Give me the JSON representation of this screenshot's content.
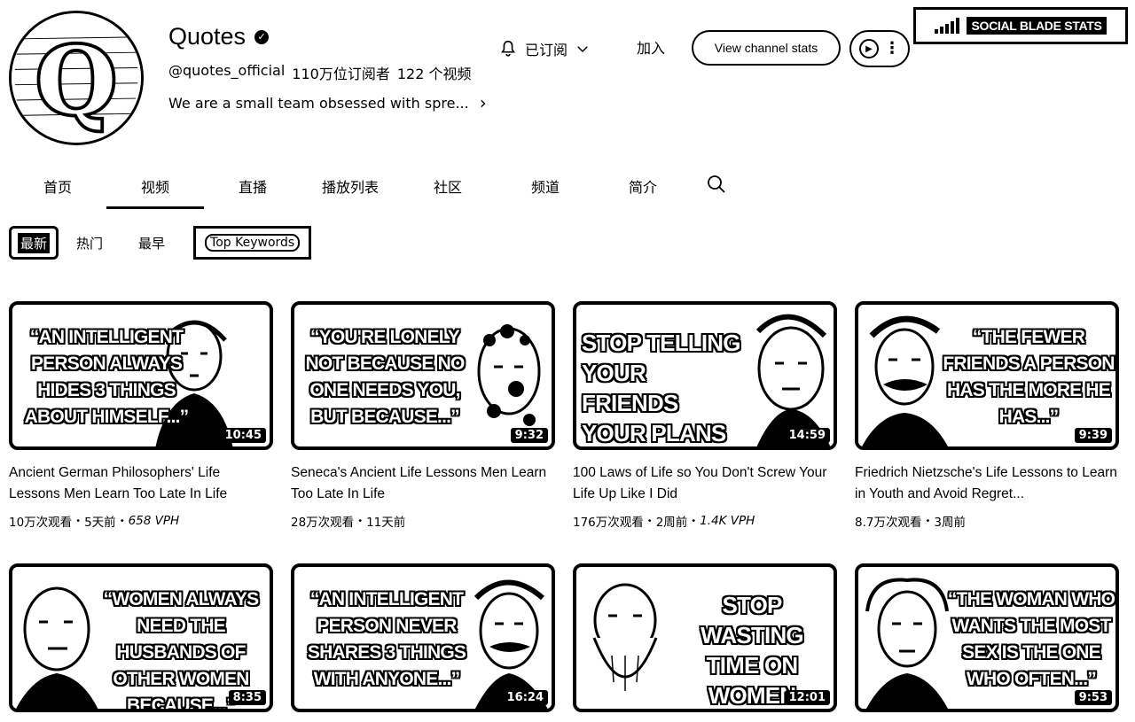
{
  "channel": {
    "name": "Quotes",
    "verified_icon": "check-icon",
    "handle": "@quotes_official",
    "subscribers": "110万位订阅者",
    "video_count": "122 个视频",
    "description": "We are a small team obsessed with spre..."
  },
  "actions": {
    "subscribed_label": "已订阅",
    "join_label": "加入",
    "stats_label": "View channel stats"
  },
  "social_blade": {
    "label": "SOCIAL BLADE STATS"
  },
  "tabs": [
    {
      "label": "首页",
      "active": false
    },
    {
      "label": "视频",
      "active": true
    },
    {
      "label": "直播",
      "active": false
    },
    {
      "label": "播放列表",
      "active": false
    },
    {
      "label": "社区",
      "active": false
    },
    {
      "label": "频道",
      "active": false
    },
    {
      "label": "简介",
      "active": false
    }
  ],
  "chips": [
    {
      "label": "最新",
      "selected": true
    },
    {
      "label": "热门",
      "selected": false
    },
    {
      "label": "最早",
      "selected": false
    },
    {
      "label": "Top Keywords",
      "selected": false
    }
  ],
  "videos": [
    {
      "quote": "“AN INTELLIGENT PERSON ALWAYS HIDES 3 THINGS ABOUT HIMSELF...”",
      "duration": "10:45",
      "title": "Ancient German Philosophers' Life Lessons Men Learn Too Late In Life",
      "views": "10万次观看",
      "age": "5天前",
      "vph": "658 VPH"
    },
    {
      "quote": "“YOU'RE LONELY NOT BECAUSE NO ONE NEEDS YOU, BUT BECAUSE...”",
      "duration": "9:32",
      "title": "Seneca's Ancient Life Lessons Men Learn Too Late In Life",
      "views": "28万次观看",
      "age": "11天前",
      "vph": ""
    },
    {
      "quote": "STOP TELLING YOUR FRIENDS YOUR PLANS",
      "duration": "14:59",
      "title": "100 Laws of Life so You Don't Screw Your Life Up Like I Did",
      "views": "176万次观看",
      "age": "2周前",
      "vph": "1.4K VPH"
    },
    {
      "quote": "“THE FEWER FRIENDS A PERSON HAS THE MORE HE HAS...”",
      "duration": "9:39",
      "title": "Friedrich Nietzsche's Life Lessons to Learn in Youth and Avoid Regret...",
      "views": "8.7万次观看",
      "age": "3周前",
      "vph": ""
    },
    {
      "quote": "“WOMEN ALWAYS NEED THE HUSBANDS OF OTHER WOMEN BECAUSE...”",
      "duration": "8:35",
      "title": "",
      "views": "",
      "age": "",
      "vph": ""
    },
    {
      "quote": "“AN INTELLIGENT PERSON NEVER SHARES 3 THINGS WITH ANYONE...”",
      "duration": "16:24",
      "title": "",
      "views": "",
      "age": "",
      "vph": ""
    },
    {
      "quote": "STOP WASTING TIME ON WOMEN",
      "duration": "12:01",
      "title": "",
      "views": "",
      "age": "",
      "vph": ""
    },
    {
      "quote": "“THE WOMAN WHO WANTS THE MOST SEX IS THE ONE WHO OFTEN...”",
      "duration": "9:53",
      "title": "",
      "views": "",
      "age": "",
      "vph": ""
    }
  ]
}
